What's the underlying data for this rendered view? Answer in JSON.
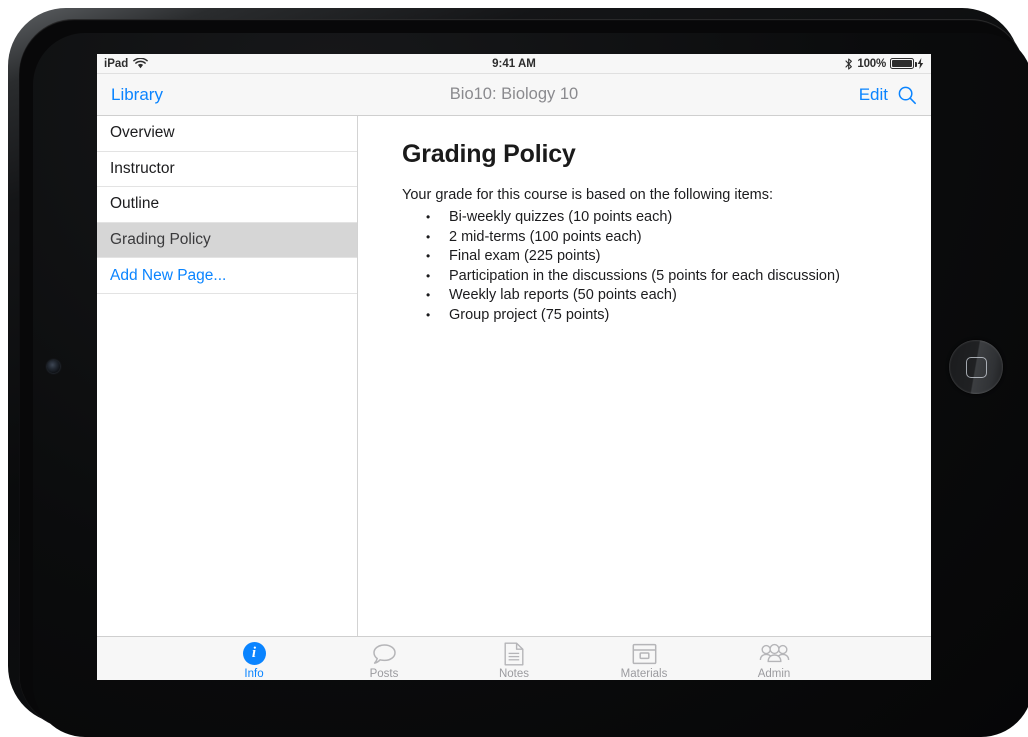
{
  "status_bar": {
    "device_label": "iPad",
    "wifi_icon": "wifi-icon",
    "time": "9:41 AM",
    "bluetooth_icon": "bluetooth-icon",
    "battery_percent": "100%",
    "battery_icon": "battery-full-icon",
    "charging_icon": "lightning-bolt-icon"
  },
  "nav_bar": {
    "back_label": "Library",
    "title": "Bio10: Biology 10",
    "edit_label": "Edit",
    "search_icon": "search-icon"
  },
  "sidebar": {
    "items": [
      {
        "label": "Overview",
        "selected": false,
        "action": false
      },
      {
        "label": "Instructor",
        "selected": false,
        "action": false
      },
      {
        "label": "Outline",
        "selected": false,
        "action": false
      },
      {
        "label": "Grading Policy",
        "selected": true,
        "action": false
      },
      {
        "label": "Add New Page...",
        "selected": false,
        "action": true
      }
    ]
  },
  "detail": {
    "title": "Grading Policy",
    "intro": "Your grade for this course is based on the following items:",
    "items": [
      "Bi-weekly quizzes (10 points each)",
      "2 mid-terms (100 points each)",
      "Final exam (225 points)",
      "Participation in the discussions (5 points for each discussion)",
      "Weekly lab reports (50 points each)",
      "Group project (75 points)"
    ]
  },
  "tab_bar": {
    "tabs": [
      {
        "label": "Info",
        "icon": "info-circle-icon",
        "active": true
      },
      {
        "label": "Posts",
        "icon": "speech-bubble-icon",
        "active": false
      },
      {
        "label": "Notes",
        "icon": "document-lines-icon",
        "active": false
      },
      {
        "label": "Materials",
        "icon": "archive-box-icon",
        "active": false
      },
      {
        "label": "Admin",
        "icon": "people-group-icon",
        "active": false
      }
    ]
  },
  "device": {
    "home_button": "home-button",
    "front_camera": "front-camera"
  },
  "colors": {
    "accent_blue": "#0a84ff",
    "selected_row": "#d6d6d6",
    "chrome_gray": "#f7f7f7",
    "inactive_tab": "#9b9b9f"
  }
}
